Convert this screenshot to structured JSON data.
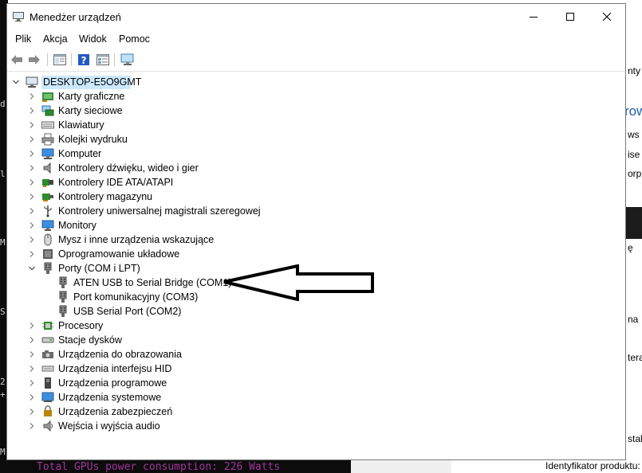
{
  "background": {
    "left_chars": [
      "d",
      "l",
      "M",
      "S",
      "2",
      "+",
      "M"
    ],
    "bottom_terminal_text": "Total GPUs power consumption: 226 Watts",
    "bottom_right_text": "Identyfikator produktu:",
    "right_fragments": [
      "nty",
      "row",
      "ws",
      "ise",
      "orp",
      "ę",
      "na",
      "tera",
      "stal"
    ]
  },
  "window": {
    "title": "Menedżer urządzeń",
    "controls": [
      "minimize",
      "maximize",
      "close"
    ]
  },
  "menu": [
    "Plik",
    "Akcja",
    "Widok",
    "Pomoc"
  ],
  "toolbar": {
    "buttons": [
      "back-icon",
      "forward-icon",
      "properties-icon",
      "help-icon",
      "view-icon",
      "monitor-scan-icon"
    ]
  },
  "tree": {
    "root": "DESKTOP-E5O9GMT",
    "categories": [
      {
        "label": "Karty graficzne",
        "icon": "display-adapter-icon",
        "expanded": false
      },
      {
        "label": "Karty sieciowe",
        "icon": "network-adapter-icon",
        "expanded": false
      },
      {
        "label": "Klawiatury",
        "icon": "keyboard-icon",
        "expanded": false
      },
      {
        "label": "Kolejki wydruku",
        "icon": "printer-icon",
        "expanded": false
      },
      {
        "label": "Komputer",
        "icon": "computer-icon",
        "expanded": false
      },
      {
        "label": "Kontrolery dźwięku, wideo i gier",
        "icon": "speaker-icon",
        "expanded": false
      },
      {
        "label": "Kontrolery IDE ATA/ATAPI",
        "icon": "ide-controller-icon",
        "expanded": false
      },
      {
        "label": "Kontrolery magazynu",
        "icon": "storage-controller-icon",
        "expanded": false
      },
      {
        "label": "Kontrolery uniwersalnej magistrali szeregowej",
        "icon": "usb-controller-icon",
        "expanded": false
      },
      {
        "label": "Monitory",
        "icon": "monitor-icon",
        "expanded": false
      },
      {
        "label": "Mysz i inne urządzenia wskazujące",
        "icon": "mouse-icon",
        "expanded": false
      },
      {
        "label": "Oprogramowanie układowe",
        "icon": "firmware-icon",
        "expanded": false
      },
      {
        "label": "Porty (COM i LPT)",
        "icon": "port-icon",
        "expanded": true,
        "children": [
          {
            "label": "ATEN USB to Serial Bridge (COM1)",
            "icon": "port-icon"
          },
          {
            "label": "Port komunikacyjny (COM3)",
            "icon": "port-icon"
          },
          {
            "label": "USB Serial Port (COM2)",
            "icon": "port-icon"
          }
        ]
      },
      {
        "label": "Procesory",
        "icon": "processor-icon",
        "expanded": false
      },
      {
        "label": "Stacje dysków",
        "icon": "disk-drive-icon",
        "expanded": false
      },
      {
        "label": "Urządzenia do obrazowania",
        "icon": "camera-icon",
        "expanded": false
      },
      {
        "label": "Urządzenia interfejsu HID",
        "icon": "hid-icon",
        "expanded": false
      },
      {
        "label": "Urządzenia programowe",
        "icon": "software-device-icon",
        "expanded": false
      },
      {
        "label": "Urządzenia systemowe",
        "icon": "system-device-icon",
        "expanded": false
      },
      {
        "label": "Urządzenia zabezpieczeń",
        "icon": "security-device-icon",
        "expanded": false
      },
      {
        "label": "Wejścia i wyjścia audio",
        "icon": "audio-io-icon",
        "expanded": false
      }
    ]
  },
  "colors": {
    "selection": "#cce8ff",
    "terminal_text": "#a3359d",
    "arrow_fill": "#ffffff",
    "arrow_stroke": "#000000"
  }
}
